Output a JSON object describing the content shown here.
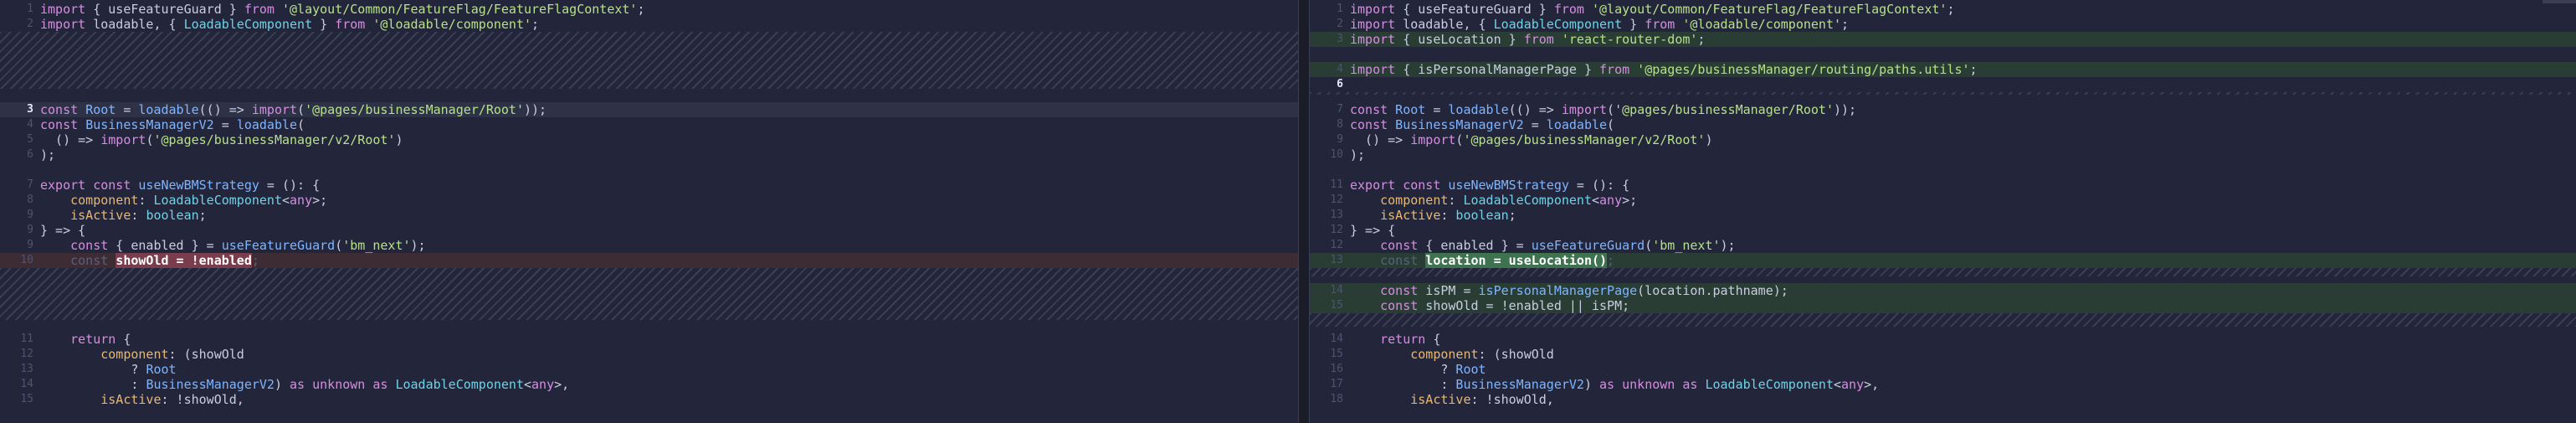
{
  "left": {
    "lines": [
      {
        "n": "1",
        "segs": [
          [
            "kw",
            "import"
          ],
          [
            "punc",
            " { useFeatureGuard } "
          ],
          [
            "kw",
            "from"
          ],
          [
            "str",
            " '@layout/Common/FeatureFlag/FeatureFlagContext'"
          ],
          [
            "punc",
            ";"
          ]
        ]
      },
      {
        "n": "2",
        "segs": [
          [
            "kw",
            "import"
          ],
          [
            "punc",
            " loadable, { "
          ],
          [
            "type",
            "LoadableComponent"
          ],
          [
            "punc",
            " } "
          ],
          [
            "kw",
            "from"
          ],
          [
            "str",
            " '@loadable/component'"
          ],
          [
            "punc",
            ";"
          ]
        ]
      },
      {
        "n": "3",
        "active": true,
        "row": "hl-row",
        "segs": [
          [
            "kw",
            "const"
          ],
          [
            "punc",
            " "
          ],
          [
            "fn",
            "Root"
          ],
          [
            "punc",
            " = "
          ],
          [
            "fn",
            "loadable"
          ],
          [
            "punc",
            "(() => "
          ],
          [
            "kw",
            "import"
          ],
          [
            "punc",
            "("
          ],
          [
            "str",
            "'@pages/businessManager/Root'"
          ],
          [
            "punc",
            "));"
          ]
        ]
      },
      {
        "n": "4",
        "segs": [
          [
            "kw",
            "const"
          ],
          [
            "punc",
            " "
          ],
          [
            "fn",
            "BusinessManagerV2"
          ],
          [
            "punc",
            " = "
          ],
          [
            "fn",
            "loadable"
          ],
          [
            "punc",
            "("
          ]
        ]
      },
      {
        "n": "5",
        "segs": [
          [
            "punc",
            "  () => "
          ],
          [
            "kw",
            "import"
          ],
          [
            "punc",
            "("
          ],
          [
            "str",
            "'@pages/businessManager/v2/Root'"
          ],
          [
            "punc",
            ")"
          ]
        ]
      },
      {
        "n": "6",
        "segs": [
          [
            "punc",
            ");"
          ]
        ]
      },
      {
        "n": "7",
        "segs": [
          [
            "kw",
            "export"
          ],
          [
            "punc",
            " "
          ],
          [
            "kw",
            "const"
          ],
          [
            "punc",
            " "
          ],
          [
            "fn",
            "useNewBMStrategy"
          ],
          [
            "punc",
            " = (): {"
          ]
        ]
      },
      {
        "n": "8",
        "segs": [
          [
            "punc",
            "    "
          ],
          [
            "prop",
            "component"
          ],
          [
            "punc",
            ": "
          ],
          [
            "type",
            "LoadableComponent"
          ],
          [
            "punc",
            "<"
          ],
          [
            "kw",
            "any"
          ],
          [
            "punc",
            ">;"
          ]
        ]
      },
      {
        "n": "9",
        "segs": [
          [
            "punc",
            "    "
          ],
          [
            "prop",
            "isActive"
          ],
          [
            "punc",
            ": "
          ],
          [
            "type",
            "boolean"
          ],
          [
            "punc",
            ";"
          ]
        ]
      },
      {
        "n": "9",
        "segs": [
          [
            "punc",
            "} => {"
          ]
        ]
      },
      {
        "n": "9",
        "segs": [
          [
            "punc",
            "    "
          ],
          [
            "kw",
            "const"
          ],
          [
            "punc",
            " { enabled } = "
          ],
          [
            "fn",
            "useFeatureGuard"
          ],
          [
            "punc",
            "("
          ],
          [
            "str",
            "'bm_next'"
          ],
          [
            "punc",
            ");"
          ]
        ]
      },
      {
        "n": "10",
        "row": "hl-red",
        "segs": [
          [
            "faded",
            "    const "
          ],
          [
            "tokred",
            "showOld = !enabled"
          ],
          [
            "faded",
            ";"
          ]
        ]
      },
      {
        "n": "11",
        "segs": [
          [
            "punc",
            "    "
          ],
          [
            "kw",
            "return"
          ],
          [
            "punc",
            " {"
          ]
        ]
      },
      {
        "n": "12",
        "segs": [
          [
            "punc",
            "        "
          ],
          [
            "prop",
            "component"
          ],
          [
            "punc",
            ": (showOld"
          ]
        ]
      },
      {
        "n": "13",
        "segs": [
          [
            "punc",
            "            ? "
          ],
          [
            "fn",
            "Root"
          ]
        ]
      },
      {
        "n": "14",
        "segs": [
          [
            "punc",
            "            : "
          ],
          [
            "fn",
            "BusinessManagerV2"
          ],
          [
            "punc",
            ") "
          ],
          [
            "kw",
            "as"
          ],
          [
            "punc",
            " "
          ],
          [
            "kw",
            "unknown"
          ],
          [
            "punc",
            " "
          ],
          [
            "kw",
            "as"
          ],
          [
            "punc",
            " "
          ],
          [
            "type",
            "LoadableComponent"
          ],
          [
            "punc",
            "<"
          ],
          [
            "kw",
            "any"
          ],
          [
            "punc",
            ">,"
          ]
        ]
      },
      {
        "n": "15",
        "segs": [
          [
            "punc",
            "        "
          ],
          [
            "prop",
            "isActive"
          ],
          [
            "punc",
            ": !showOld,"
          ]
        ]
      }
    ]
  },
  "right": {
    "lines": [
      {
        "n": "1",
        "segs": [
          [
            "kw",
            "import"
          ],
          [
            "punc",
            " { useFeatureGuard } "
          ],
          [
            "kw",
            "from"
          ],
          [
            "str",
            " '@layout/Common/FeatureFlag/FeatureFlagContext'"
          ],
          [
            "punc",
            ";"
          ]
        ]
      },
      {
        "n": "2",
        "segs": [
          [
            "kw",
            "import"
          ],
          [
            "punc",
            " loadable, { "
          ],
          [
            "type",
            "LoadableComponent"
          ],
          [
            "punc",
            " } "
          ],
          [
            "kw",
            "from"
          ],
          [
            "str",
            " '@loadable/component'"
          ],
          [
            "punc",
            ";"
          ]
        ]
      },
      {
        "n": "3",
        "row": "hl-green",
        "segs": [
          [
            "kw",
            "import"
          ],
          [
            "punc",
            " { useLocation } "
          ],
          [
            "kw",
            "from"
          ],
          [
            "str",
            " 'react-router-dom'"
          ],
          [
            "punc",
            ";"
          ]
        ]
      },
      {
        "n": "4",
        "row": "hl-green",
        "segs": [
          [
            "kw",
            "import"
          ],
          [
            "punc",
            " { isPersonalManagerPage } "
          ],
          [
            "kw",
            "from"
          ],
          [
            "str",
            " '@pages/businessManager/routing/paths.utils'"
          ],
          [
            "punc",
            ";"
          ]
        ]
      },
      {
        "n": "6",
        "active": true,
        "segs": []
      },
      {
        "n": "7",
        "segs": [
          [
            "kw",
            "const"
          ],
          [
            "punc",
            " "
          ],
          [
            "fn",
            "Root"
          ],
          [
            "punc",
            " = "
          ],
          [
            "fn",
            "loadable"
          ],
          [
            "punc",
            "(() => "
          ],
          [
            "kw",
            "import"
          ],
          [
            "punc",
            "("
          ],
          [
            "str",
            "'@pages/businessManager/Root'"
          ],
          [
            "punc",
            "));"
          ]
        ]
      },
      {
        "n": "8",
        "segs": [
          [
            "kw",
            "const"
          ],
          [
            "punc",
            " "
          ],
          [
            "fn",
            "BusinessManagerV2"
          ],
          [
            "punc",
            " = "
          ],
          [
            "fn",
            "loadable"
          ],
          [
            "punc",
            "("
          ]
        ]
      },
      {
        "n": "9",
        "segs": [
          [
            "punc",
            "  () => "
          ],
          [
            "kw",
            "import"
          ],
          [
            "punc",
            "("
          ],
          [
            "str",
            "'@pages/businessManager/v2/Root'"
          ],
          [
            "punc",
            ")"
          ]
        ]
      },
      {
        "n": "10",
        "segs": [
          [
            "punc",
            ");"
          ]
        ]
      },
      {
        "n": "11",
        "segs": [
          [
            "kw",
            "export"
          ],
          [
            "punc",
            " "
          ],
          [
            "kw",
            "const"
          ],
          [
            "punc",
            " "
          ],
          [
            "fn",
            "useNewBMStrategy"
          ],
          [
            "punc",
            " = (): {"
          ]
        ]
      },
      {
        "n": "12",
        "segs": [
          [
            "punc",
            "    "
          ],
          [
            "prop",
            "component"
          ],
          [
            "punc",
            ": "
          ],
          [
            "type",
            "LoadableComponent"
          ],
          [
            "punc",
            "<"
          ],
          [
            "kw",
            "any"
          ],
          [
            "punc",
            ">;"
          ]
        ]
      },
      {
        "n": "13",
        "segs": [
          [
            "punc",
            "    "
          ],
          [
            "prop",
            "isActive"
          ],
          [
            "punc",
            ": "
          ],
          [
            "type",
            "boolean"
          ],
          [
            "punc",
            ";"
          ]
        ]
      },
      {
        "n": "12",
        "segs": [
          [
            "punc",
            "} => {"
          ]
        ]
      },
      {
        "n": "12",
        "segs": [
          [
            "punc",
            "    "
          ],
          [
            "kw",
            "const"
          ],
          [
            "punc",
            " { enabled } = "
          ],
          [
            "fn",
            "useFeatureGuard"
          ],
          [
            "punc",
            "("
          ],
          [
            "str",
            "'bm_next'"
          ],
          [
            "punc",
            ");"
          ]
        ]
      },
      {
        "n": "13",
        "row": "hl-green",
        "segs": [
          [
            "faded",
            "    const "
          ],
          [
            "tokgreen",
            "location = useLocation()"
          ],
          [
            "faded",
            ";"
          ]
        ]
      },
      {
        "n": "14",
        "row": "hl-green",
        "segs": [
          [
            "punc",
            "    "
          ],
          [
            "kw",
            "const"
          ],
          [
            "punc",
            " isPM = "
          ],
          [
            "fn",
            "isPersonalManagerPage"
          ],
          [
            "punc",
            "(location.pathname);"
          ]
        ]
      },
      {
        "n": "15",
        "row": "hl-green",
        "segs": [
          [
            "punc",
            "    "
          ],
          [
            "kw",
            "const"
          ],
          [
            "punc",
            " showOld = !enabled || isPM;"
          ]
        ]
      },
      {
        "n": "14",
        "segs": [
          [
            "punc",
            "    "
          ],
          [
            "kw",
            "return"
          ],
          [
            "punc",
            " {"
          ]
        ]
      },
      {
        "n": "15",
        "segs": [
          [
            "punc",
            "        "
          ],
          [
            "prop",
            "component"
          ],
          [
            "punc",
            ": (showOld"
          ]
        ]
      },
      {
        "n": "16",
        "segs": [
          [
            "punc",
            "            ? "
          ],
          [
            "fn",
            "Root"
          ]
        ]
      },
      {
        "n": "17",
        "segs": [
          [
            "punc",
            "            : "
          ],
          [
            "fn",
            "BusinessManagerV2"
          ],
          [
            "punc",
            ") "
          ],
          [
            "kw",
            "as"
          ],
          [
            "punc",
            " "
          ],
          [
            "kw",
            "unknown"
          ],
          [
            "punc",
            " "
          ],
          [
            "kw",
            "as"
          ],
          [
            "punc",
            " "
          ],
          [
            "type",
            "LoadableComponent"
          ],
          [
            "punc",
            "<"
          ],
          [
            "kw",
            "any"
          ],
          [
            "punc",
            ">,"
          ]
        ]
      },
      {
        "n": "18",
        "segs": [
          [
            "punc",
            "        "
          ],
          [
            "prop",
            "isActive"
          ],
          [
            "punc",
            ": !showOld,"
          ]
        ]
      }
    ]
  }
}
